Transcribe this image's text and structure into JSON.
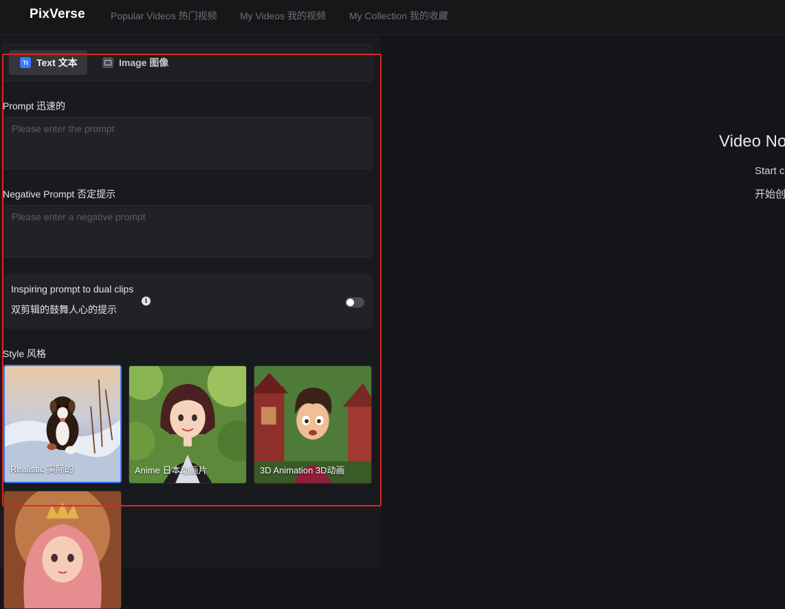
{
  "header": {
    "logo": "PixVerse",
    "nav": [
      {
        "label": "Popular Videos 热门视频"
      },
      {
        "label": "My Videos 我的视频"
      },
      {
        "label": "My Collection 我的收藏"
      }
    ]
  },
  "tabs": {
    "text": {
      "label": "Text 文本",
      "icon": "Tt"
    },
    "image": {
      "label": "Image 图像"
    }
  },
  "prompt": {
    "label": "Prompt 迅速的",
    "placeholder": "Please enter the prompt",
    "value": ""
  },
  "negative_prompt": {
    "label": "Negative Prompt 否定提示",
    "placeholder": "Please enter a negative prompt",
    "value": ""
  },
  "inspire": {
    "line1": "Inspiring prompt to dual clips",
    "line2": "双剪辑的鼓舞人心的提示",
    "info_glyph": "i",
    "enabled": false
  },
  "style": {
    "label": "Style 风格",
    "options": [
      {
        "label": "Realistic 实际的",
        "selected": true
      },
      {
        "label": "Anime 日本动画片",
        "selected": false
      },
      {
        "label": "3D Animation 3D动画",
        "selected": false
      },
      {
        "label": "",
        "selected": false
      }
    ]
  },
  "preview": {
    "title": "Video No",
    "line1": "Start c",
    "line2": "开始创"
  },
  "colors": {
    "accent": "#3a7bfd",
    "annotation_box": "#e0261f",
    "background": "#141518"
  }
}
